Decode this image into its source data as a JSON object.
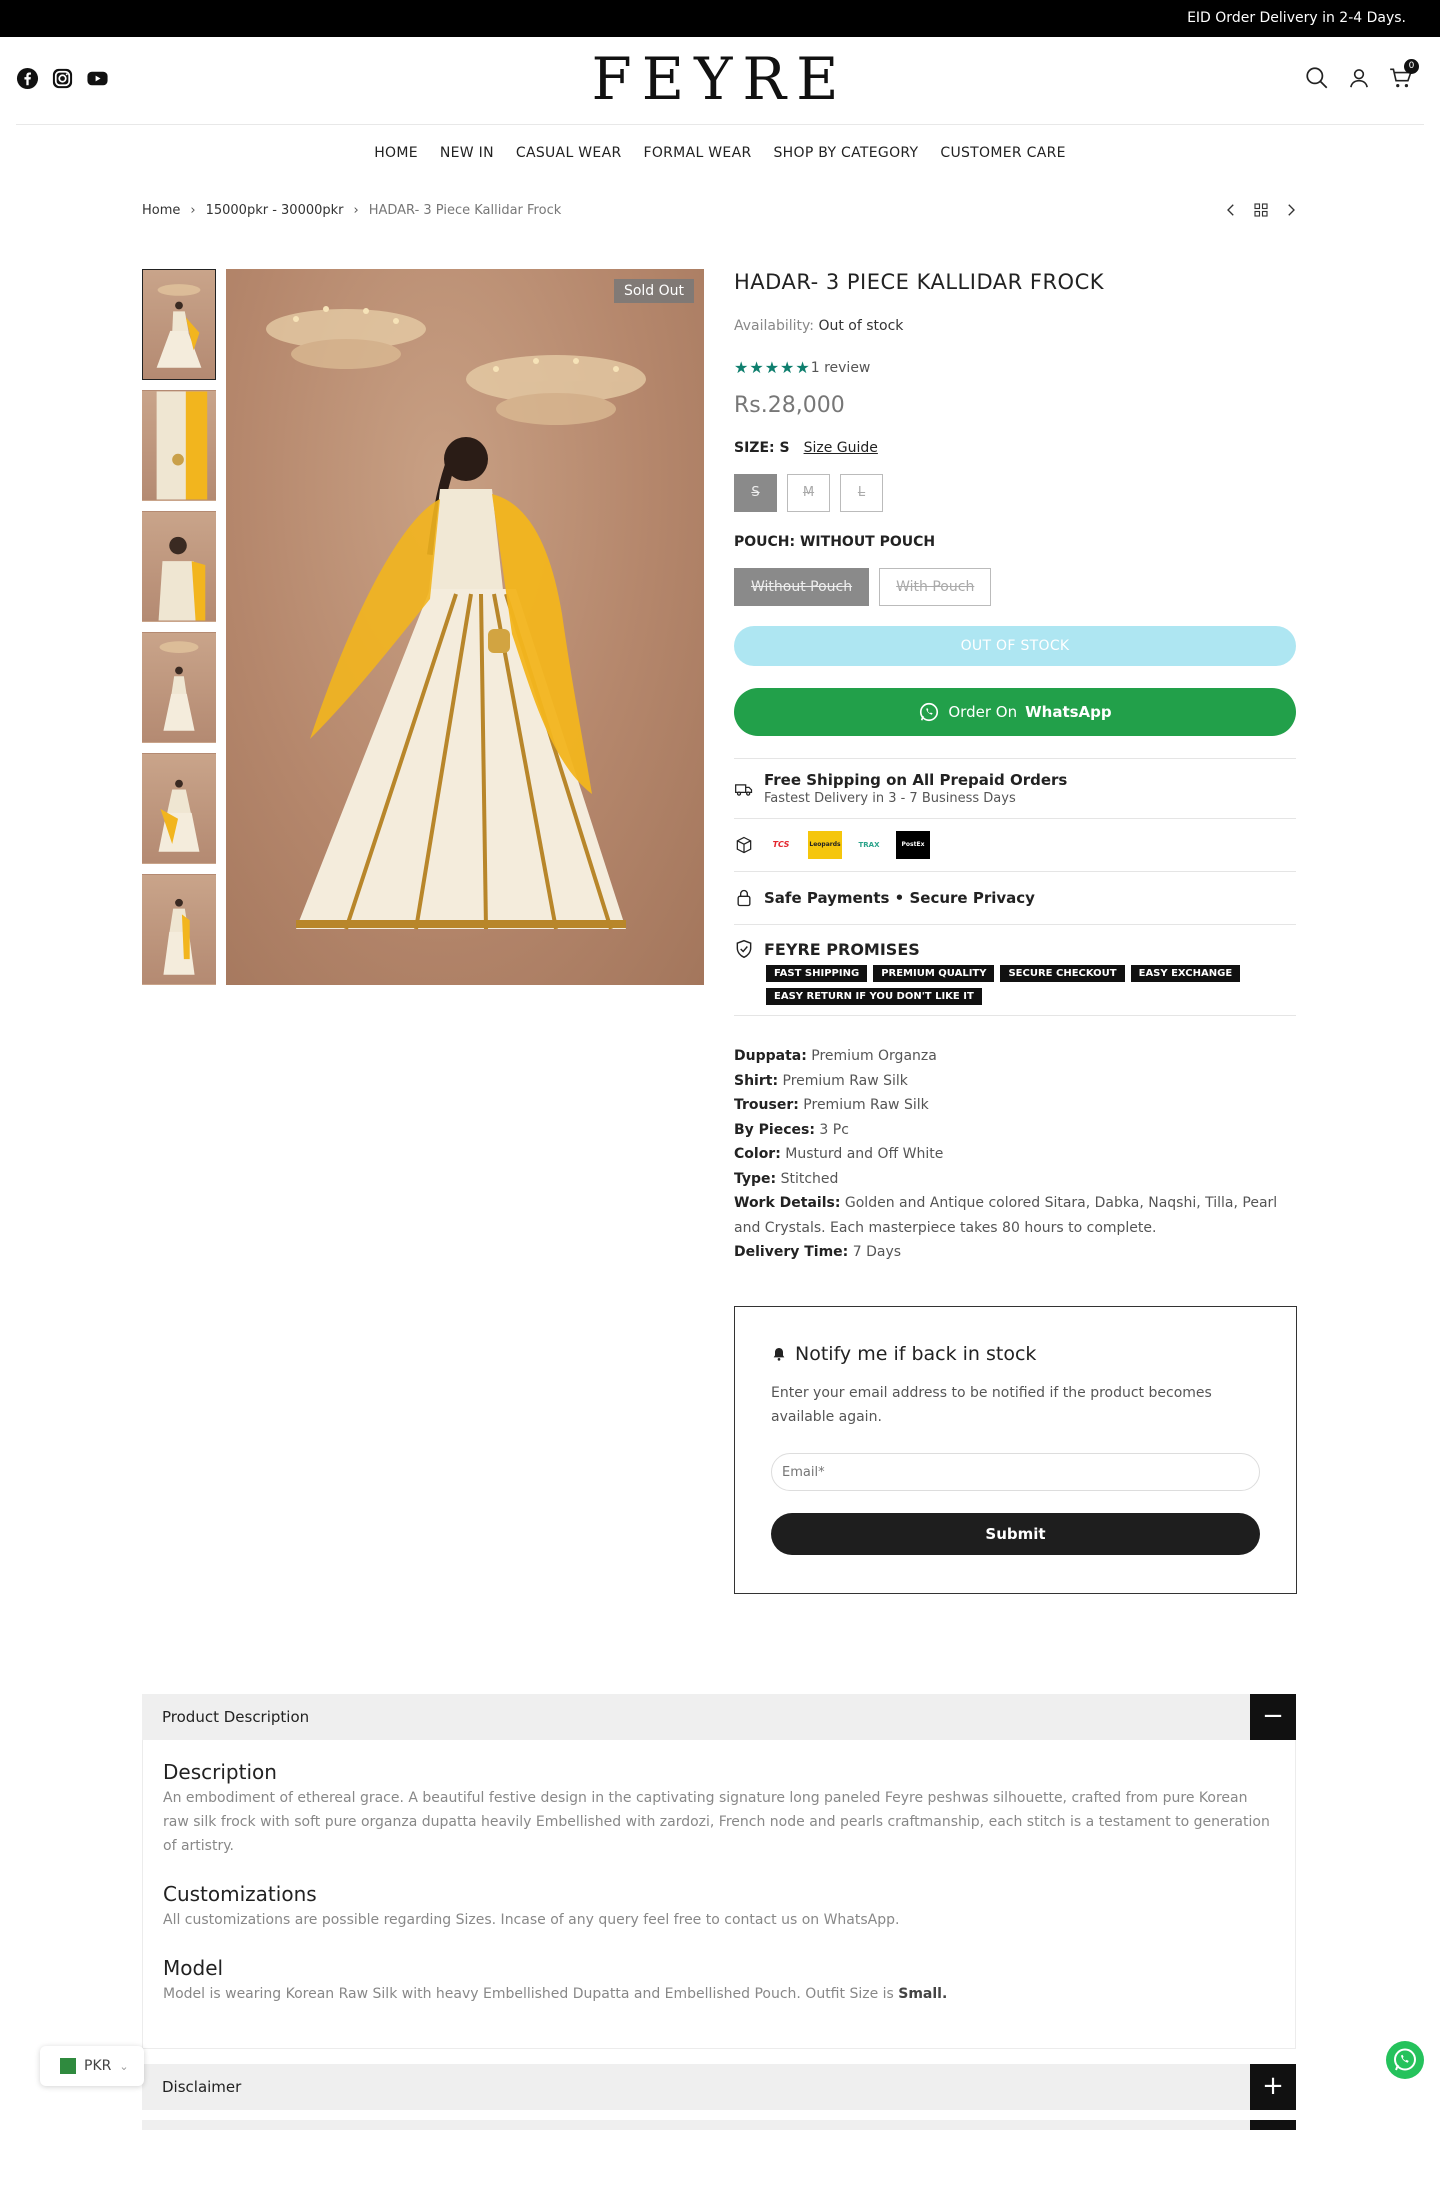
{
  "topbar": {
    "announcement": "EID Order Delivery in 2-4 Days."
  },
  "header": {
    "logo": "FEYRE",
    "cart_count": "0"
  },
  "nav": {
    "items": [
      "HOME",
      "NEW IN",
      "CASUAL WEAR",
      "FORMAL WEAR",
      "SHOP BY CATEGORY",
      "CUSTOMER CARE"
    ]
  },
  "breadcrumb": {
    "home": "Home",
    "category": "15000pkr - 30000pkr",
    "current": "HADAR- 3 Piece Kallidar Frock"
  },
  "gallery": {
    "badge": "Sold Out",
    "thumb_count": 6
  },
  "product": {
    "title": "HADAR- 3 PIECE KALLIDAR FROCK",
    "availability_label": "Availability:",
    "availability_value": "Out of stock",
    "stars": 5,
    "reviews": "1 review",
    "price": "Rs.28,000",
    "size_label": "SIZE: S",
    "size_guide": "Size Guide",
    "sizes": [
      "S",
      "M",
      "L"
    ],
    "pouch_label": "POUCH: WITHOUT POUCH",
    "pouch_options": [
      "Without Pouch",
      "With Pouch"
    ],
    "oos_button": "OUT OF STOCK",
    "whatsapp_prefix": "Order On",
    "whatsapp_brand": "WhatsApp",
    "shipping_title": "Free Shipping on All Prepaid Orders",
    "shipping_sub": "Fastest Delivery in 3 - 7 Business Days",
    "couriers": [
      "TCS",
      "Leopards",
      "TRAX",
      "PostEx"
    ],
    "secure": "Safe Payments • Secure Privacy",
    "promises_title": "FEYRE PROMISES",
    "promises": [
      "FAST SHIPPING",
      "PREMIUM QUALITY",
      "SECURE CHECKOUT",
      "EASY EXCHANGE",
      "EASY RETURN IF YOU DON'T LIKE IT"
    ],
    "details": [
      {
        "label": "Duppata:",
        "value": "Premium Organza"
      },
      {
        "label": "Shirt:",
        "value": "Premium Raw Silk"
      },
      {
        "label": "Trouser:",
        "value": "Premium Raw Silk"
      },
      {
        "label": "By Pieces:",
        "value": "3 Pc"
      },
      {
        "label": "Color:",
        "value": "Musturd and Off White"
      },
      {
        "label": "Type:",
        "value": "Stitched"
      },
      {
        "label": "Work Details:",
        "value": "Golden and Antique colored Sitara, Dabka, Naqshi, Tilla, Pearl and Crystals. Each masterpiece takes 80 hours to complete."
      },
      {
        "label": "Delivery Time:",
        "value": "7 Days"
      }
    ]
  },
  "notify": {
    "title": "Notify me if back in stock",
    "text": "Enter your email address to be notified if the product becomes available again.",
    "email_placeholder": "Email*",
    "submit": "Submit"
  },
  "accordion": {
    "desc_title": "Product Description",
    "desc_toggle": "−",
    "sections": [
      {
        "heading": "Description",
        "text": "An embodiment of ethereal grace. A beautiful festive design in the captivating  signature long paneled  Feyre peshwas silhouette, crafted from pure Korean raw silk frock with  soft pure organza dupatta  heavily Embellished with zardozi, French node and pearls craftmanship, each stitch is a testament to generation of artistry."
      },
      {
        "heading": "Customizations",
        "text": "All customizations are possible regarding Sizes. Incase of any query feel free to contact us on WhatsApp."
      },
      {
        "heading": "Model",
        "text": "Model is wearing Korean Raw Silk with heavy Embellished Dupatta and Embellished Pouch. Outfit Size is",
        "bold": "Small."
      }
    ],
    "disclaimer_title": "Disclaimer",
    "disclaimer_toggle": "+"
  },
  "currency": {
    "code": "PKR"
  }
}
